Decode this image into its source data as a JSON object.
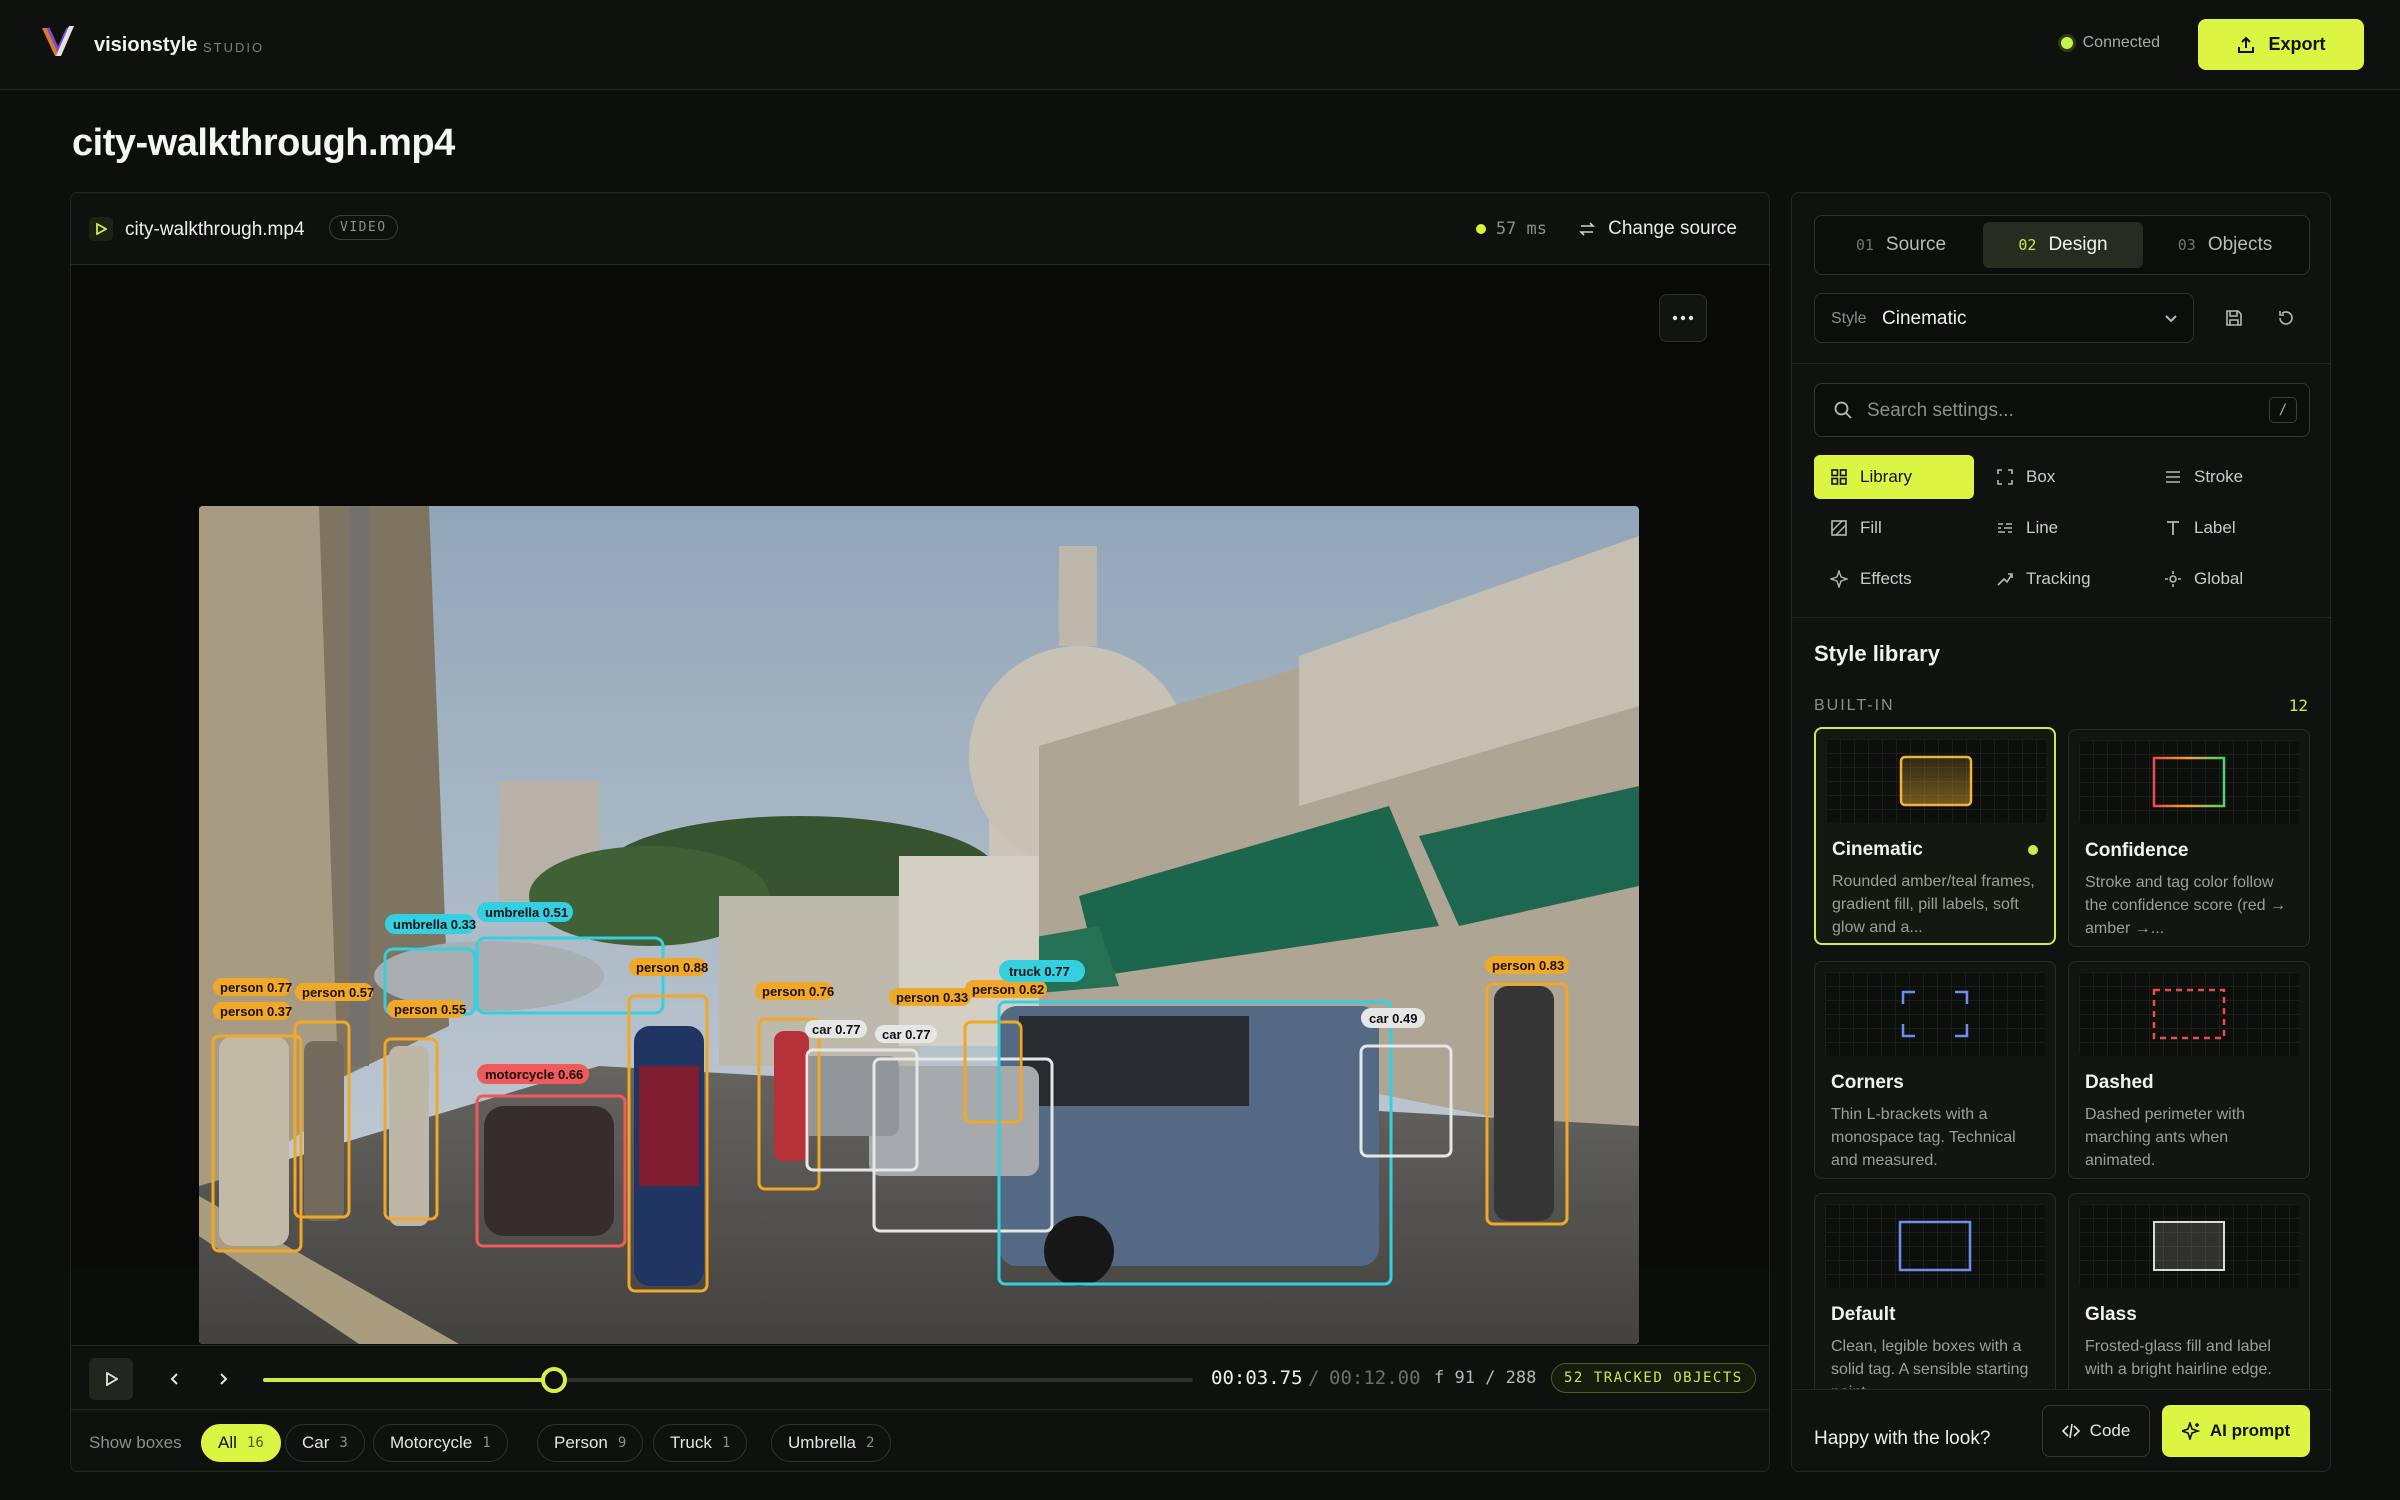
{
  "app": {
    "brand": "visionstyle",
    "brand_sub": "STUDIO",
    "status": "Connected",
    "export_label": "Export"
  },
  "page": {
    "title": "city-walkthrough.mp4"
  },
  "viewer": {
    "file_name": "city-walkthrough.mp4",
    "file_type": "VIDEO",
    "latency": "57 ms",
    "change_source": "Change source",
    "detections": [
      {
        "label": "umbrella 0.33"
      },
      {
        "label": "umbrella 0.51"
      },
      {
        "label": "person 0.77"
      },
      {
        "label": "person 0.57"
      },
      {
        "label": "person 0.37"
      },
      {
        "label": "person 0.55"
      },
      {
        "label": "person 0.88"
      },
      {
        "label": "motorcycle 0.66"
      },
      {
        "label": "person 0.76"
      },
      {
        "label": "car 0.77"
      },
      {
        "label": "car 0.77"
      },
      {
        "label": "person 0.33"
      },
      {
        "label": "person 0.62"
      },
      {
        "label": "truck 0.77"
      },
      {
        "label": "car 0.49"
      },
      {
        "label": "person 0.83"
      }
    ]
  },
  "playback": {
    "current": "00:03.75",
    "separator": "/",
    "total": "00:12.00",
    "frame": "f 91 / 288",
    "tracked": "52 TRACKED OBJECTS",
    "progress": 0.3125
  },
  "filters": {
    "label": "Show boxes",
    "chips": [
      {
        "label": "All",
        "count": "16"
      },
      {
        "label": "Car",
        "count": "3"
      },
      {
        "label": "Motorcycle",
        "count": "1"
      },
      {
        "label": "Person",
        "count": "9"
      },
      {
        "label": "Truck",
        "count": "1"
      },
      {
        "label": "Umbrella",
        "count": "2"
      }
    ]
  },
  "side": {
    "steps": [
      {
        "num": "01",
        "label": "Source"
      },
      {
        "num": "02",
        "label": "Design"
      },
      {
        "num": "03",
        "label": "Objects"
      }
    ],
    "style_key": "Style",
    "style_value": "Cinematic",
    "search_placeholder": "Search settings...",
    "search_key": "/",
    "categories": [
      {
        "label": "Library"
      },
      {
        "label": "Box"
      },
      {
        "label": "Stroke"
      },
      {
        "label": "Fill"
      },
      {
        "label": "Line"
      },
      {
        "label": "Label"
      },
      {
        "label": "Effects"
      },
      {
        "label": "Tracking"
      },
      {
        "label": "Global"
      }
    ],
    "library_title": "Style library",
    "library_section": "BUILT-IN",
    "library_count": "12",
    "cards": [
      {
        "title": "Cinematic",
        "desc": "Rounded amber/teal frames, gradient fill, pill labels, soft glow and a..."
      },
      {
        "title": "Confidence",
        "desc": "Stroke and tag color follow the confidence score (red → amber →..."
      },
      {
        "title": "Corners",
        "desc": "Thin L-brackets with a monospace tag. Technical and measured."
      },
      {
        "title": "Dashed",
        "desc": "Dashed perimeter with marching ants when animated."
      },
      {
        "title": "Default",
        "desc": "Clean, legible boxes with a solid tag. A sensible starting point."
      },
      {
        "title": "Glass",
        "desc": "Frosted-glass fill and label with a bright hairline edge."
      }
    ],
    "footer_question": "Happy with the look?",
    "code_label": "Code",
    "ai_label": "AI prompt"
  },
  "colors": {
    "accent": "#dbf542",
    "person": "#f0a826",
    "car": "#e6e6e6",
    "truck": "#35d0e0",
    "umbrella": "#35d0e0",
    "motorcycle": "#ef5a5a"
  }
}
